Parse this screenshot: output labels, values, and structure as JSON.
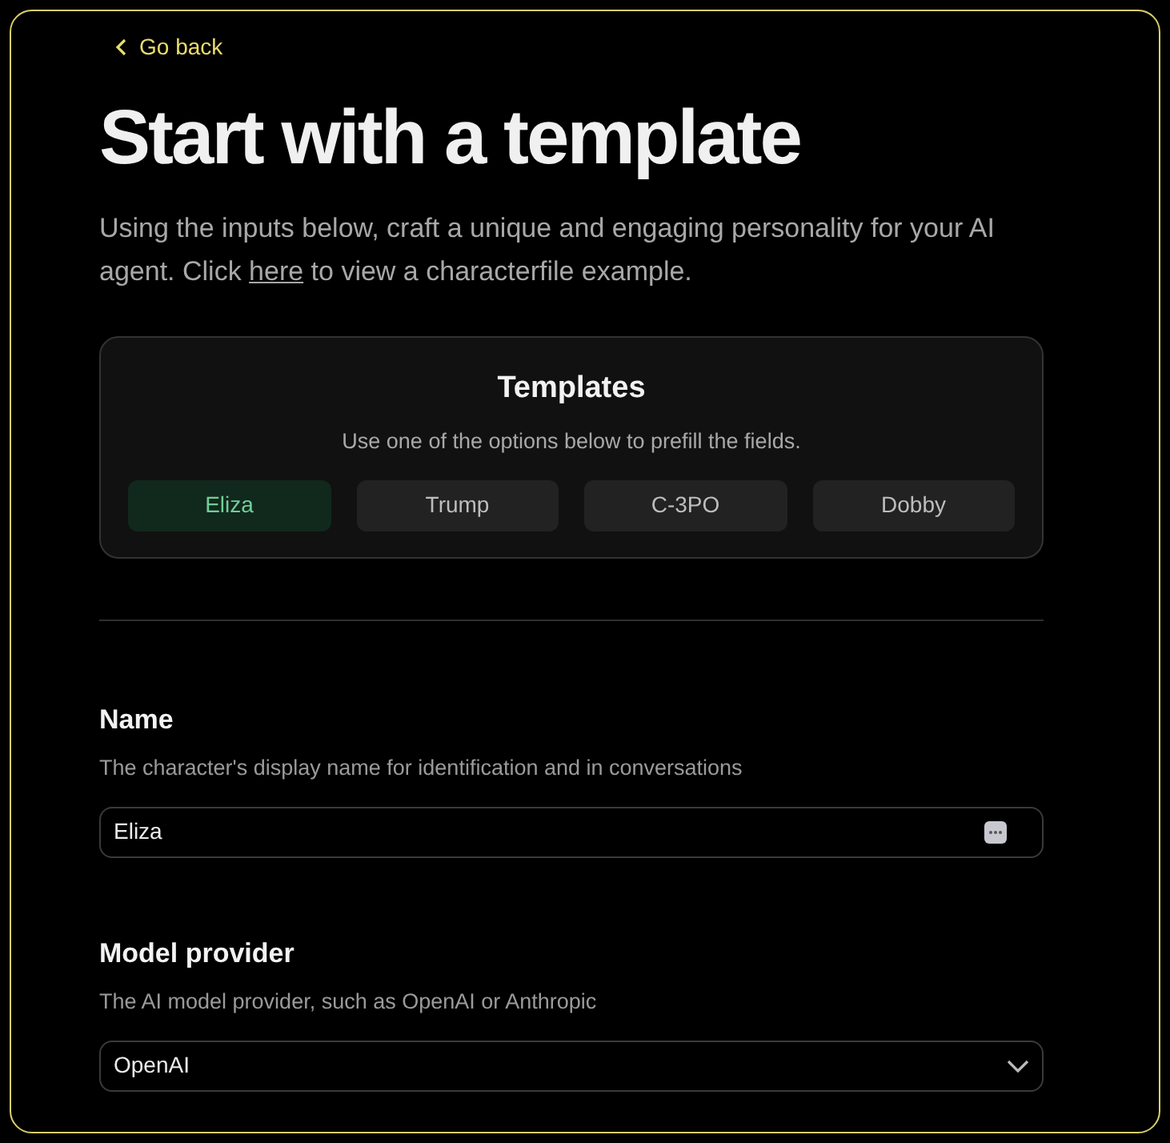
{
  "back_link": "Go back",
  "title": "Start with a template",
  "intro": {
    "before": "Using the inputs below, craft a unique and engaging personality for your AI agent. Click ",
    "link": "here",
    "after": " to view a characterfile example."
  },
  "templates": {
    "title": "Templates",
    "subtitle": "Use one of the options below to prefill the fields.",
    "options": [
      {
        "label": "Eliza",
        "selected": true
      },
      {
        "label": "Trump",
        "selected": false
      },
      {
        "label": "C-3PO",
        "selected": false
      },
      {
        "label": "Dobby",
        "selected": false
      }
    ]
  },
  "fields": [
    {
      "kind": "text",
      "label": "Name",
      "description": "The character's display name for identification and in conversations",
      "value": "Eliza"
    },
    {
      "kind": "select",
      "label": "Model provider",
      "description": "The AI model provider, such as OpenAI or Anthropic",
      "value": "OpenAI"
    }
  ]
}
